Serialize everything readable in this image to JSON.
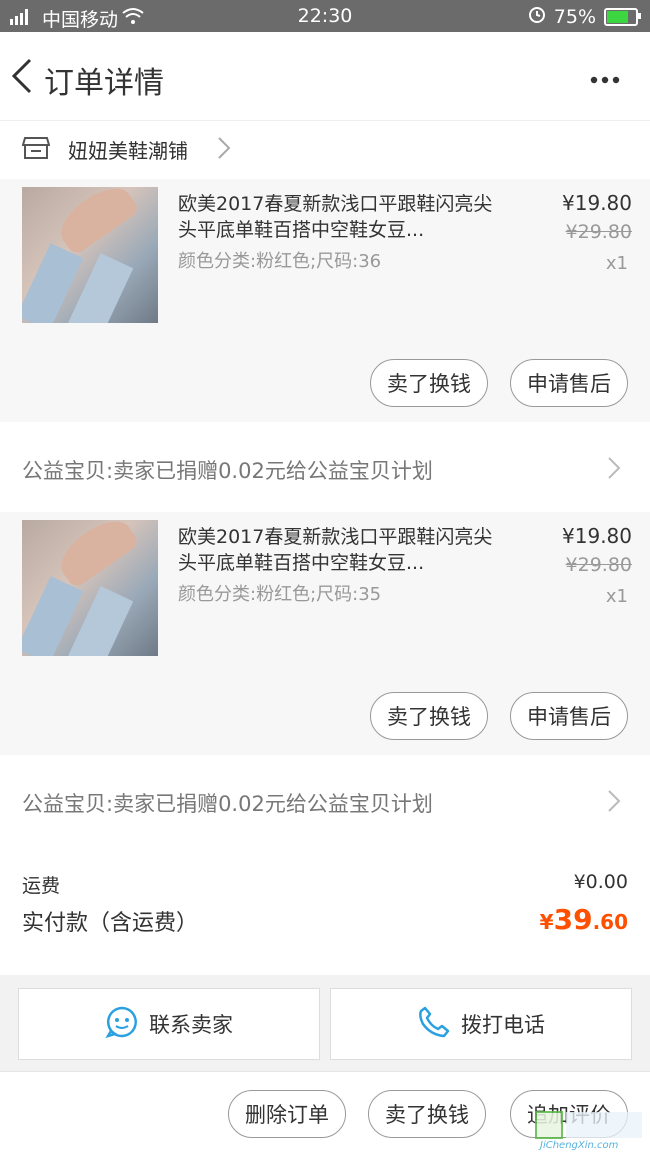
{
  "status_bar": {
    "carrier": "中国移动",
    "time": "22:30",
    "battery": "75%"
  },
  "nav": {
    "title": "订单详情"
  },
  "shop": {
    "name": "妞妞美鞋潮铺"
  },
  "items": [
    {
      "title": "欧美2017春夏新款浅口平跟鞋闪亮尖头平底单鞋百搭中空鞋女豆...",
      "sku": "颜色分类:粉红色;尺码:36",
      "price": "¥19.80",
      "original_price": "¥29.80",
      "quantity": "x1",
      "btn_sell": "卖了换钱",
      "btn_aftersale": "申请售后",
      "charity": "公益宝贝:卖家已捐赠0.02元给公益宝贝计划"
    },
    {
      "title": "欧美2017春夏新款浅口平跟鞋闪亮尖头平底单鞋百搭中空鞋女豆...",
      "sku": "颜色分类:粉红色;尺码:35",
      "price": "¥19.80",
      "original_price": "¥29.80",
      "quantity": "x1",
      "btn_sell": "卖了换钱",
      "btn_aftersale": "申请售后",
      "charity": "公益宝贝:卖家已捐赠0.02元给公益宝贝计划"
    }
  ],
  "totals": {
    "shipping_label": "运费",
    "shipping_value": "¥0.00",
    "paid_label": "实付款（含运费）",
    "paid_currency": "¥",
    "paid_integer": "39",
    "paid_decimal": ".60"
  },
  "contact": {
    "seller_label": "联系卖家",
    "phone_label": "拨打电话"
  },
  "bottom_actions": {
    "delete": "删除订单",
    "sell": "卖了换钱",
    "review": "追加评价"
  },
  "watermark": {
    "text": "JiChengXin.com"
  },
  "colors": {
    "accent": "#ff5000",
    "contact_icon": "#2ba0e0"
  }
}
